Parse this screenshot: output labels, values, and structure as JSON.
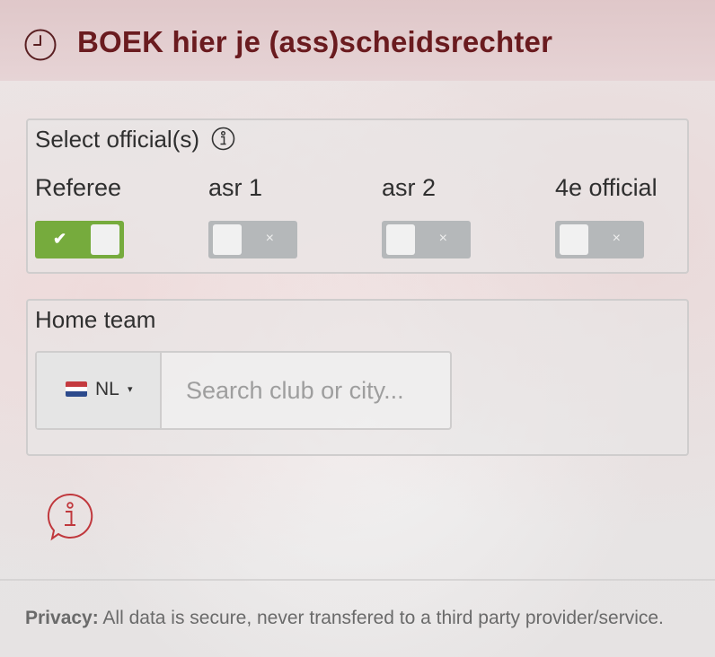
{
  "header": {
    "title": "BOEK hier je (ass)scheidsrechter",
    "icon": "clock-icon"
  },
  "officials": {
    "legend": "Select official(s)",
    "items": [
      {
        "label": "Referee",
        "on": true,
        "mark": "✔"
      },
      {
        "label": "asr 1",
        "on": false,
        "mark": "×"
      },
      {
        "label": "asr 2",
        "on": false,
        "mark": "×"
      },
      {
        "label": "4e official",
        "on": false,
        "mark": "×"
      }
    ]
  },
  "home_team": {
    "legend": "Home team",
    "country_code": "NL",
    "caret": "▾",
    "search_placeholder": "Search club or city..."
  },
  "footer": {
    "privacy_label": "Privacy:",
    "privacy_text": "All data is secure, never transfered to a third party provider/service."
  },
  "colors": {
    "accent": "#6a1b1f",
    "toggle_on": "#76ab3d",
    "toggle_off": "#b5b8ba",
    "info_icon": "#c0383d"
  }
}
